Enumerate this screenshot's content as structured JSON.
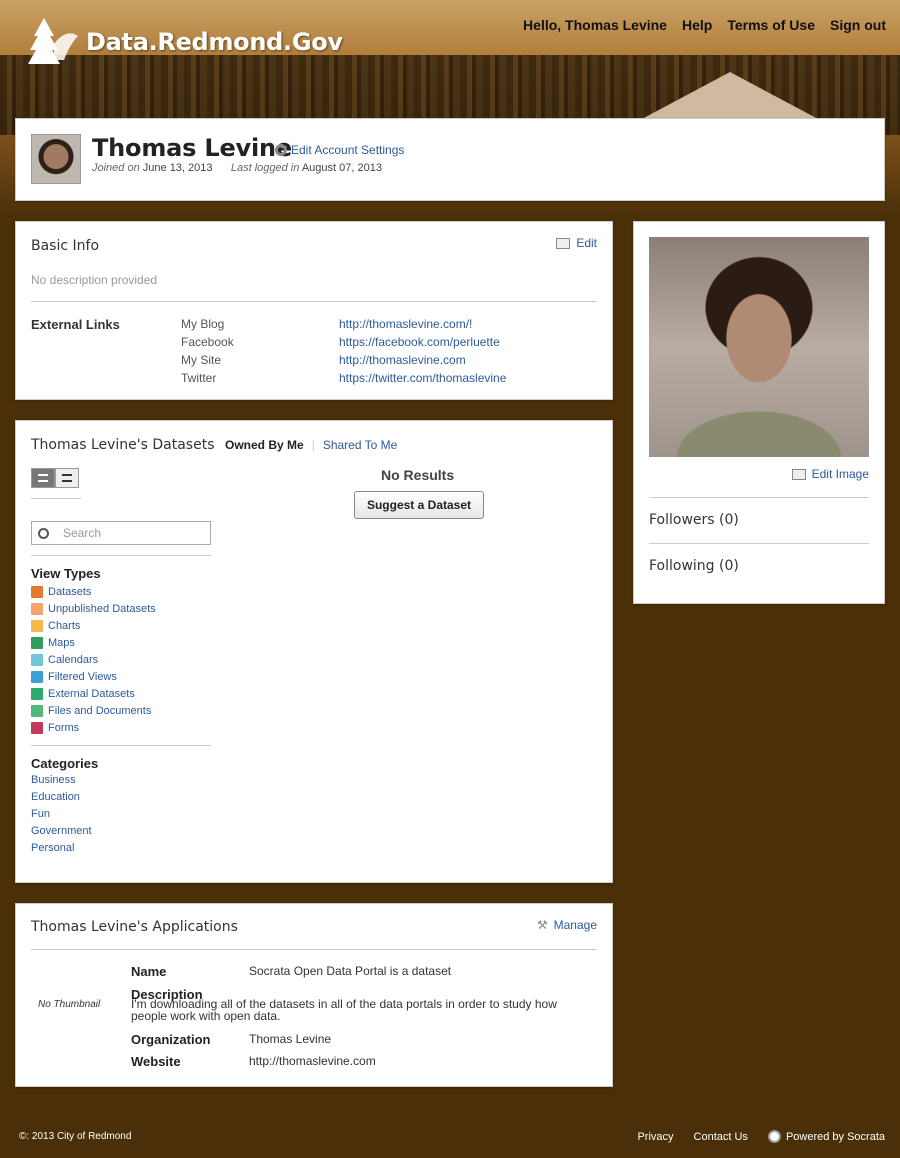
{
  "site": {
    "name": "Data.Redmond.Gov"
  },
  "topnav": {
    "greeting": "Hello, Thomas Levine",
    "help": "Help",
    "terms": "Terms of Use",
    "signout": "Sign out"
  },
  "profile": {
    "name": "Thomas Levine",
    "edit_account": "Edit Account Settings",
    "joined_label": "Joined on",
    "joined": "June 13, 2013",
    "last_label": "Last logged in",
    "last": "August 07, 2013"
  },
  "basic_info": {
    "title": "Basic Info",
    "edit": "Edit",
    "description": "No description provided",
    "external_links_label": "External Links",
    "links": [
      {
        "name": "My Blog",
        "url": "http://thomaslevine.com/!"
      },
      {
        "name": "Facebook",
        "url": "https://facebook.com/perluette"
      },
      {
        "name": "My Site",
        "url": "http://thomaslevine.com"
      },
      {
        "name": "Twitter",
        "url": "https://twitter.com/thomaslevine"
      }
    ]
  },
  "photo_panel": {
    "edit_image": "Edit Image",
    "followers": "Followers (0)",
    "following": "Following (0)"
  },
  "datasets": {
    "title": "Thomas Levine's Datasets",
    "tab_owned": "Owned By Me",
    "tab_shared": "Shared To Me",
    "search_placeholder": "Search",
    "view_types_title": "View Types",
    "view_types": [
      {
        "label": "Datasets",
        "color": "#e07a2e"
      },
      {
        "label": "Unpublished Datasets",
        "color": "#f2a66a"
      },
      {
        "label": "Charts",
        "color": "#f5b84a"
      },
      {
        "label": "Maps",
        "color": "#2e9e5a"
      },
      {
        "label": "Calendars",
        "color": "#6cc8d8"
      },
      {
        "label": "Filtered Views",
        "color": "#3aa0d8"
      },
      {
        "label": "External Datasets",
        "color": "#2eaa6e"
      },
      {
        "label": "Files and Documents",
        "color": "#4fb87a"
      },
      {
        "label": "Forms",
        "color": "#c43a5e"
      }
    ],
    "categories_title": "Categories",
    "categories": [
      "Business",
      "Education",
      "Fun",
      "Government",
      "Personal"
    ],
    "no_results": "No Results",
    "suggest": "Suggest a Dataset"
  },
  "applications": {
    "title": "Thomas Levine's Applications",
    "manage": "Manage",
    "no_thumbnail": "No Thumbnail",
    "name_label": "Name",
    "name": "Socrata Open Data Portal is a dataset",
    "description_label": "Description",
    "description": "I'm downloading all of the datasets in all of the data portals in order to study how people work with open data.",
    "org_label": "Organization",
    "org": "Thomas Levine",
    "website_label": "Website",
    "website": "http://thomaslevine.com"
  },
  "footer": {
    "copyright": "©: 2013 City of Redmond",
    "privacy": "Privacy",
    "contact": "Contact Us",
    "powered": "Powered by Socrata"
  }
}
